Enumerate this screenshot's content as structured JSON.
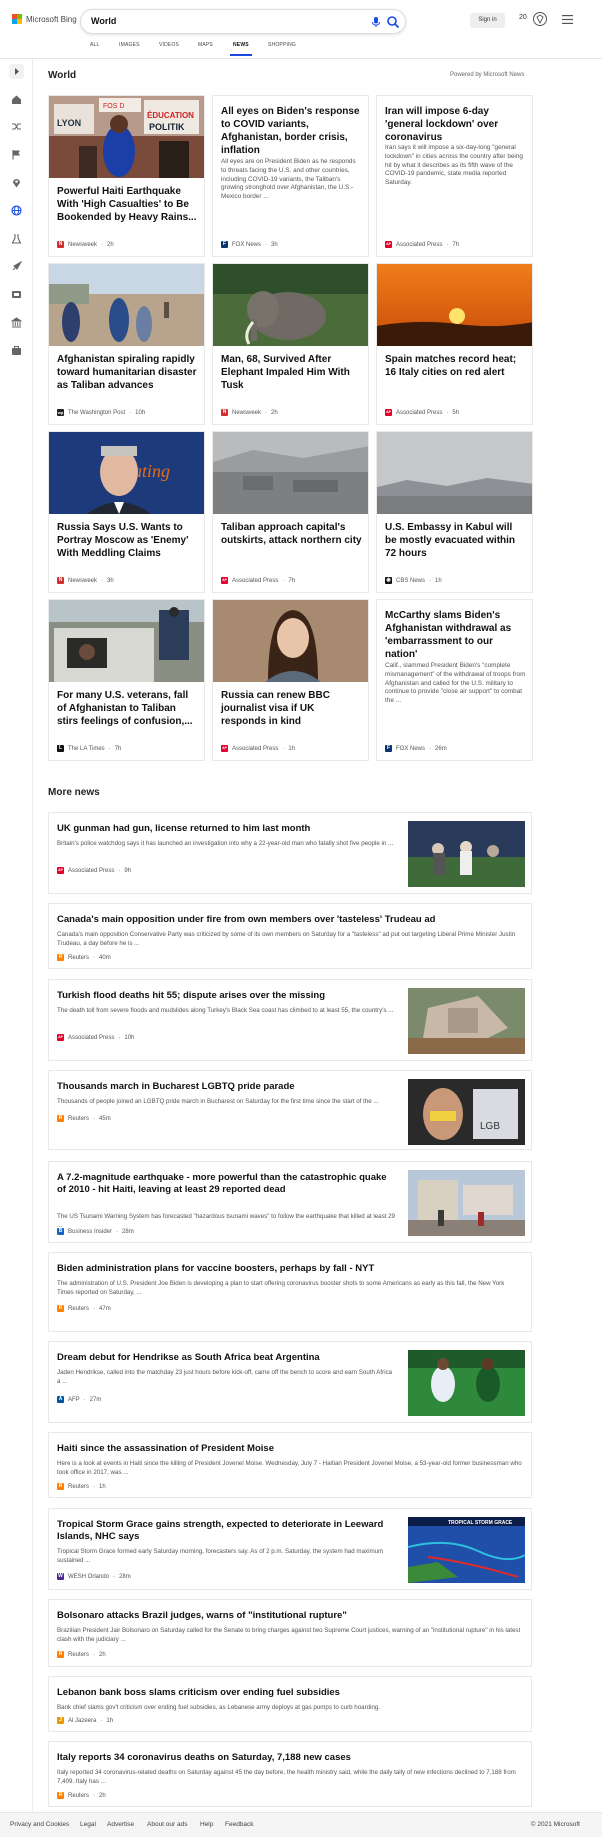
{
  "header": {
    "logo_text": "Microsoft Bing",
    "search_value": "World",
    "signin": "Sign in",
    "points": "20"
  },
  "tabs": [
    "ALL",
    "IMAGES",
    "VIDEOS",
    "MAPS",
    "NEWS",
    "SHOPPING"
  ],
  "active_tab": "NEWS",
  "sidebar_icons": [
    "expand-icon",
    "home-icon",
    "shuffle-icon",
    "flag-icon",
    "location-icon",
    "globe-icon",
    "science-icon",
    "rocket-icon",
    "entertainment-icon",
    "money-icon",
    "briefcase-icon"
  ],
  "section": {
    "title": "World",
    "powered_by": "Powered by Microsoft News"
  },
  "cards": [
    {
      "title": "Powerful Haiti Earthquake With 'High Casualties' to Be Bookended by Heavy Rains...",
      "source": "Newsweek",
      "time": "2h",
      "src_icon": "N",
      "src_color": "#d32f2f"
    },
    {
      "title": "All eyes on Biden's response to COVID variants, Afghanistan, border crisis, inflation",
      "snippet": "All eyes are on President Biden as he responds to threats facing the U.S. and other countries, including COVID-19 variants, the Taliban's growing stronghold over Afghanistan, the U.S.-Mexico border ...",
      "source": "FOX News",
      "time": "3h",
      "src_icon": "F",
      "src_color": "#0a3470"
    },
    {
      "title": "Iran will impose 6-day 'general lockdown' over coronavirus",
      "snippet": "Iran says it will impose a six-day-long \"general lockdown\" in cities across the country after being hit by what it describes as its fifth wave of the COVID-19 pandemic, state media reported Saturday.",
      "source": "Associated Press",
      "time": "7h",
      "src_icon": "AP",
      "src_color": "#e4002b"
    },
    {
      "title": "Afghanistan spiraling rapidly toward humanitarian disaster as Taliban advances",
      "source": "The Washington Post",
      "time": "10h",
      "src_icon": "wp",
      "src_color": "#222"
    },
    {
      "title": "Man, 68, Survived After Elephant Impaled Him With Tusk",
      "source": "Newsweek",
      "time": "2h",
      "src_icon": "N",
      "src_color": "#d32f2f"
    },
    {
      "title": "Spain matches record heat; 16 Italy cities on red alert",
      "source": "Associated Press",
      "time": "5h",
      "src_icon": "AP",
      "src_color": "#e4002b"
    },
    {
      "title": "Russia Says U.S. Wants to Portray Moscow as 'Enemy' With Meddling Claims",
      "source": "Newsweek",
      "time": "3h",
      "src_icon": "N",
      "src_color": "#d32f2f"
    },
    {
      "title": "Taliban approach capital's outskirts, attack northern city",
      "source": "Associated Press",
      "time": "7h",
      "src_icon": "AP",
      "src_color": "#e4002b"
    },
    {
      "title": "U.S. Embassy in Kabul will be mostly evacuated within 72 hours",
      "source": "CBS News",
      "time": "1h",
      "src_icon": "◉",
      "src_color": "#111"
    },
    {
      "title": "For many U.S. veterans, fall of Afghanistan to Taliban stirs feelings of confusion,...",
      "source": "The LA Times",
      "time": "7h",
      "src_icon": "L",
      "src_color": "#111"
    },
    {
      "title": "Russia can renew BBC journalist visa if UK responds in kind",
      "source": "Associated Press",
      "time": "1h",
      "src_icon": "AP",
      "src_color": "#e4002b"
    },
    {
      "title": "McCarthy slams Biden's Afghanistan withdrawal as 'embarrassment to our nation'",
      "snippet": "Calif., slammed President Biden's \"complete mismanagement\" of the withdrawal of troops from Afghanistan and called for the U.S. military to continue to provide \"close air support\" to combat the ...",
      "source": "FOX News",
      "time": "26m",
      "src_icon": "F",
      "src_color": "#0a3470"
    }
  ],
  "more_news": {
    "title": "More news",
    "items": [
      {
        "title": "UK gunman had gun, license returned to him last month",
        "snippet": "Britain's police watchdog says it has launched an investigation into why a 22-year-old man who fatally shot five people in ...",
        "source": "Associated Press",
        "time": "9h",
        "src_icon": "AP",
        "src_color": "#e4002b"
      },
      {
        "title": "Canada's main opposition under fire from own members over 'tasteless' Trudeau ad",
        "snippet": "Canada's main opposition Conservative Party was criticized by some of its own members on Saturday for a \"tasteless\" ad put out targeting Liberal Prime Minister Justin Trudeau, a day before he is ...",
        "source": "Reuters",
        "time": "40m",
        "src_icon": "R",
        "src_color": "#ff8000"
      },
      {
        "title": "Turkish flood deaths hit 55; dispute arises over the missing",
        "snippet": "The death toll from severe floods and mudslides along Turkey's Black Sea coast has climbed to at least 55, the country's ...",
        "source": "Associated Press",
        "time": "10h",
        "src_icon": "AP",
        "src_color": "#e4002b"
      },
      {
        "title": "Thousands march in Bucharest LGBTQ pride parade",
        "snippet": "Thousands of people joined an LGBTQ pride march in Bucharest on Saturday for the first time since the start of the ...",
        "source": "Reuters",
        "time": "45m",
        "src_icon": "R",
        "src_color": "#ff8000"
      },
      {
        "title": "A 7.2-magnitude earthquake - more powerful than the catastrophic quake of 2010 - hit Haiti, leaving at least 29 reported dead",
        "snippet": "The US Tsunami Warning System has forecasted \"hazardous tsunami waves\" to follow the earthquake that killed at least 29 ...",
        "source": "Business Insider",
        "time": "28m",
        "src_icon": "B",
        "src_color": "#1565c0"
      },
      {
        "title": "Biden administration plans for vaccine boosters, perhaps by fall - NYT",
        "snippet": "The administration of U.S. President Joe Biden is developing a plan to start offering coronavirus booster shots to some Americans as early as this fall, the New York Times reported on Saturday, ...",
        "source": "Reuters",
        "time": "47m",
        "src_icon": "R",
        "src_color": "#ff8000"
      },
      {
        "title": "Dream debut for Hendrikse as South Africa beat Argentina",
        "snippet": "Jaden Hendrikse, called into the matchday 23 just hours before kick-off, came off the bench to score and earn South Africa a ...",
        "source": "AFP",
        "time": "27m",
        "src_icon": "A",
        "src_color": "#0056a3"
      },
      {
        "title": "Haiti since the assassination of President Moise",
        "snippet": "Here is a look at events in Haiti since the killing of President Jovenel Moise. Wednesday, July 7 - Haitian President Jovenel Moise, a 53-year-old former businessman who took office in 2017, was ...",
        "source": "Reuters",
        "time": "1h",
        "src_icon": "R",
        "src_color": "#ff8000"
      },
      {
        "title": "Tropical Storm Grace gains strength, expected to deteriorate in Leeward Islands, NHC says",
        "snippet": "Tropical Storm Grace formed early Saturday morning, forecasters say. As of 2 p.m. Saturday, the system had maximum sustained ...",
        "source": "WESH Orlando",
        "time": "28m",
        "src_icon": "W",
        "src_color": "#4a2c8f"
      },
      {
        "title": "Bolsonaro attacks Brazil judges, warns of \"institutional rupture\"",
        "snippet": "Brazilian President Jair Bolsonaro on Saturday called for the Senate to bring charges against two Supreme Court justices, warning of an \"institutional rupture\" in his latest clash with the judiciary ...",
        "source": "Reuters",
        "time": "2h",
        "src_icon": "R",
        "src_color": "#ff8000"
      },
      {
        "title": "Lebanon bank boss slams criticism over ending fuel subsidies",
        "snippet": "Bank chief slams gov't criticism over ending fuel subsidies, as Lebanese army deploys at gas pumps to curb hoarding.",
        "source": "Al Jazeera",
        "time": "1h",
        "src_icon": "J",
        "src_color": "#e79b00"
      },
      {
        "title": "Italy reports 34 coronavirus deaths on Saturday, 7,188 new cases",
        "snippet": "Italy reported 34 coronavirus-related deaths on Saturday against 45 the day before, the health ministry said, while the daily tally of new infections declined to 7,188 from 7,409. Italy has ...",
        "source": "Reuters",
        "time": "2h",
        "src_icon": "R",
        "src_color": "#ff8000"
      }
    ]
  },
  "footer": {
    "links": [
      "Privacy and Cookies",
      "Legal",
      "Advertise",
      "About our ads",
      "Help",
      "Feedback"
    ],
    "copyright": "© 2021 Microsoft"
  },
  "colors": {
    "accent": "#174ae4",
    "logo": [
      "#f25022",
      "#7fba00",
      "#00a4ef",
      "#ffb900"
    ]
  }
}
